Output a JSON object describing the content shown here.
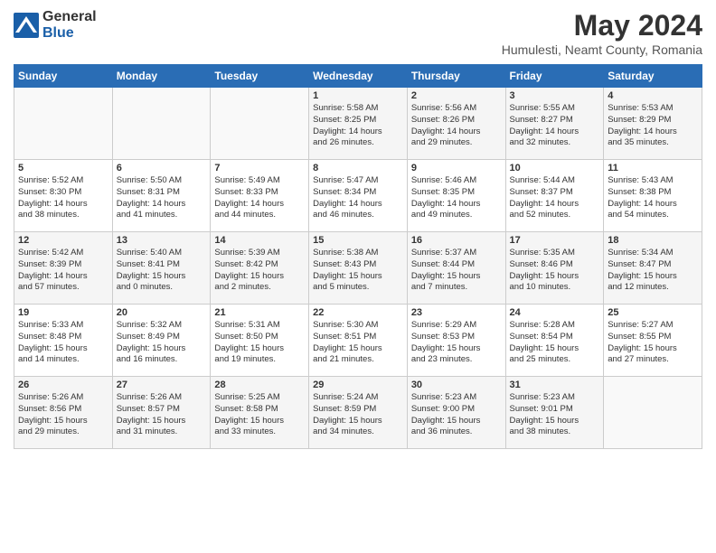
{
  "logo": {
    "general": "General",
    "blue": "Blue"
  },
  "header": {
    "monthYear": "May 2024",
    "location": "Humulesti, Neamt County, Romania"
  },
  "days": [
    "Sunday",
    "Monday",
    "Tuesday",
    "Wednesday",
    "Thursday",
    "Friday",
    "Saturday"
  ],
  "weeks": [
    [
      {
        "day": "",
        "info": ""
      },
      {
        "day": "",
        "info": ""
      },
      {
        "day": "",
        "info": ""
      },
      {
        "day": "1",
        "info": "Sunrise: 5:58 AM\nSunset: 8:25 PM\nDaylight: 14 hours\nand 26 minutes."
      },
      {
        "day": "2",
        "info": "Sunrise: 5:56 AM\nSunset: 8:26 PM\nDaylight: 14 hours\nand 29 minutes."
      },
      {
        "day": "3",
        "info": "Sunrise: 5:55 AM\nSunset: 8:27 PM\nDaylight: 14 hours\nand 32 minutes."
      },
      {
        "day": "4",
        "info": "Sunrise: 5:53 AM\nSunset: 8:29 PM\nDaylight: 14 hours\nand 35 minutes."
      }
    ],
    [
      {
        "day": "5",
        "info": "Sunrise: 5:52 AM\nSunset: 8:30 PM\nDaylight: 14 hours\nand 38 minutes."
      },
      {
        "day": "6",
        "info": "Sunrise: 5:50 AM\nSunset: 8:31 PM\nDaylight: 14 hours\nand 41 minutes."
      },
      {
        "day": "7",
        "info": "Sunrise: 5:49 AM\nSunset: 8:33 PM\nDaylight: 14 hours\nand 44 minutes."
      },
      {
        "day": "8",
        "info": "Sunrise: 5:47 AM\nSunset: 8:34 PM\nDaylight: 14 hours\nand 46 minutes."
      },
      {
        "day": "9",
        "info": "Sunrise: 5:46 AM\nSunset: 8:35 PM\nDaylight: 14 hours\nand 49 minutes."
      },
      {
        "day": "10",
        "info": "Sunrise: 5:44 AM\nSunset: 8:37 PM\nDaylight: 14 hours\nand 52 minutes."
      },
      {
        "day": "11",
        "info": "Sunrise: 5:43 AM\nSunset: 8:38 PM\nDaylight: 14 hours\nand 54 minutes."
      }
    ],
    [
      {
        "day": "12",
        "info": "Sunrise: 5:42 AM\nSunset: 8:39 PM\nDaylight: 14 hours\nand 57 minutes."
      },
      {
        "day": "13",
        "info": "Sunrise: 5:40 AM\nSunset: 8:41 PM\nDaylight: 15 hours\nand 0 minutes."
      },
      {
        "day": "14",
        "info": "Sunrise: 5:39 AM\nSunset: 8:42 PM\nDaylight: 15 hours\nand 2 minutes."
      },
      {
        "day": "15",
        "info": "Sunrise: 5:38 AM\nSunset: 8:43 PM\nDaylight: 15 hours\nand 5 minutes."
      },
      {
        "day": "16",
        "info": "Sunrise: 5:37 AM\nSunset: 8:44 PM\nDaylight: 15 hours\nand 7 minutes."
      },
      {
        "day": "17",
        "info": "Sunrise: 5:35 AM\nSunset: 8:46 PM\nDaylight: 15 hours\nand 10 minutes."
      },
      {
        "day": "18",
        "info": "Sunrise: 5:34 AM\nSunset: 8:47 PM\nDaylight: 15 hours\nand 12 minutes."
      }
    ],
    [
      {
        "day": "19",
        "info": "Sunrise: 5:33 AM\nSunset: 8:48 PM\nDaylight: 15 hours\nand 14 minutes."
      },
      {
        "day": "20",
        "info": "Sunrise: 5:32 AM\nSunset: 8:49 PM\nDaylight: 15 hours\nand 16 minutes."
      },
      {
        "day": "21",
        "info": "Sunrise: 5:31 AM\nSunset: 8:50 PM\nDaylight: 15 hours\nand 19 minutes."
      },
      {
        "day": "22",
        "info": "Sunrise: 5:30 AM\nSunset: 8:51 PM\nDaylight: 15 hours\nand 21 minutes."
      },
      {
        "day": "23",
        "info": "Sunrise: 5:29 AM\nSunset: 8:53 PM\nDaylight: 15 hours\nand 23 minutes."
      },
      {
        "day": "24",
        "info": "Sunrise: 5:28 AM\nSunset: 8:54 PM\nDaylight: 15 hours\nand 25 minutes."
      },
      {
        "day": "25",
        "info": "Sunrise: 5:27 AM\nSunset: 8:55 PM\nDaylight: 15 hours\nand 27 minutes."
      }
    ],
    [
      {
        "day": "26",
        "info": "Sunrise: 5:26 AM\nSunset: 8:56 PM\nDaylight: 15 hours\nand 29 minutes."
      },
      {
        "day": "27",
        "info": "Sunrise: 5:26 AM\nSunset: 8:57 PM\nDaylight: 15 hours\nand 31 minutes."
      },
      {
        "day": "28",
        "info": "Sunrise: 5:25 AM\nSunset: 8:58 PM\nDaylight: 15 hours\nand 33 minutes."
      },
      {
        "day": "29",
        "info": "Sunrise: 5:24 AM\nSunset: 8:59 PM\nDaylight: 15 hours\nand 34 minutes."
      },
      {
        "day": "30",
        "info": "Sunrise: 5:23 AM\nSunset: 9:00 PM\nDaylight: 15 hours\nand 36 minutes."
      },
      {
        "day": "31",
        "info": "Sunrise: 5:23 AM\nSunset: 9:01 PM\nDaylight: 15 hours\nand 38 minutes."
      },
      {
        "day": "",
        "info": ""
      }
    ]
  ]
}
